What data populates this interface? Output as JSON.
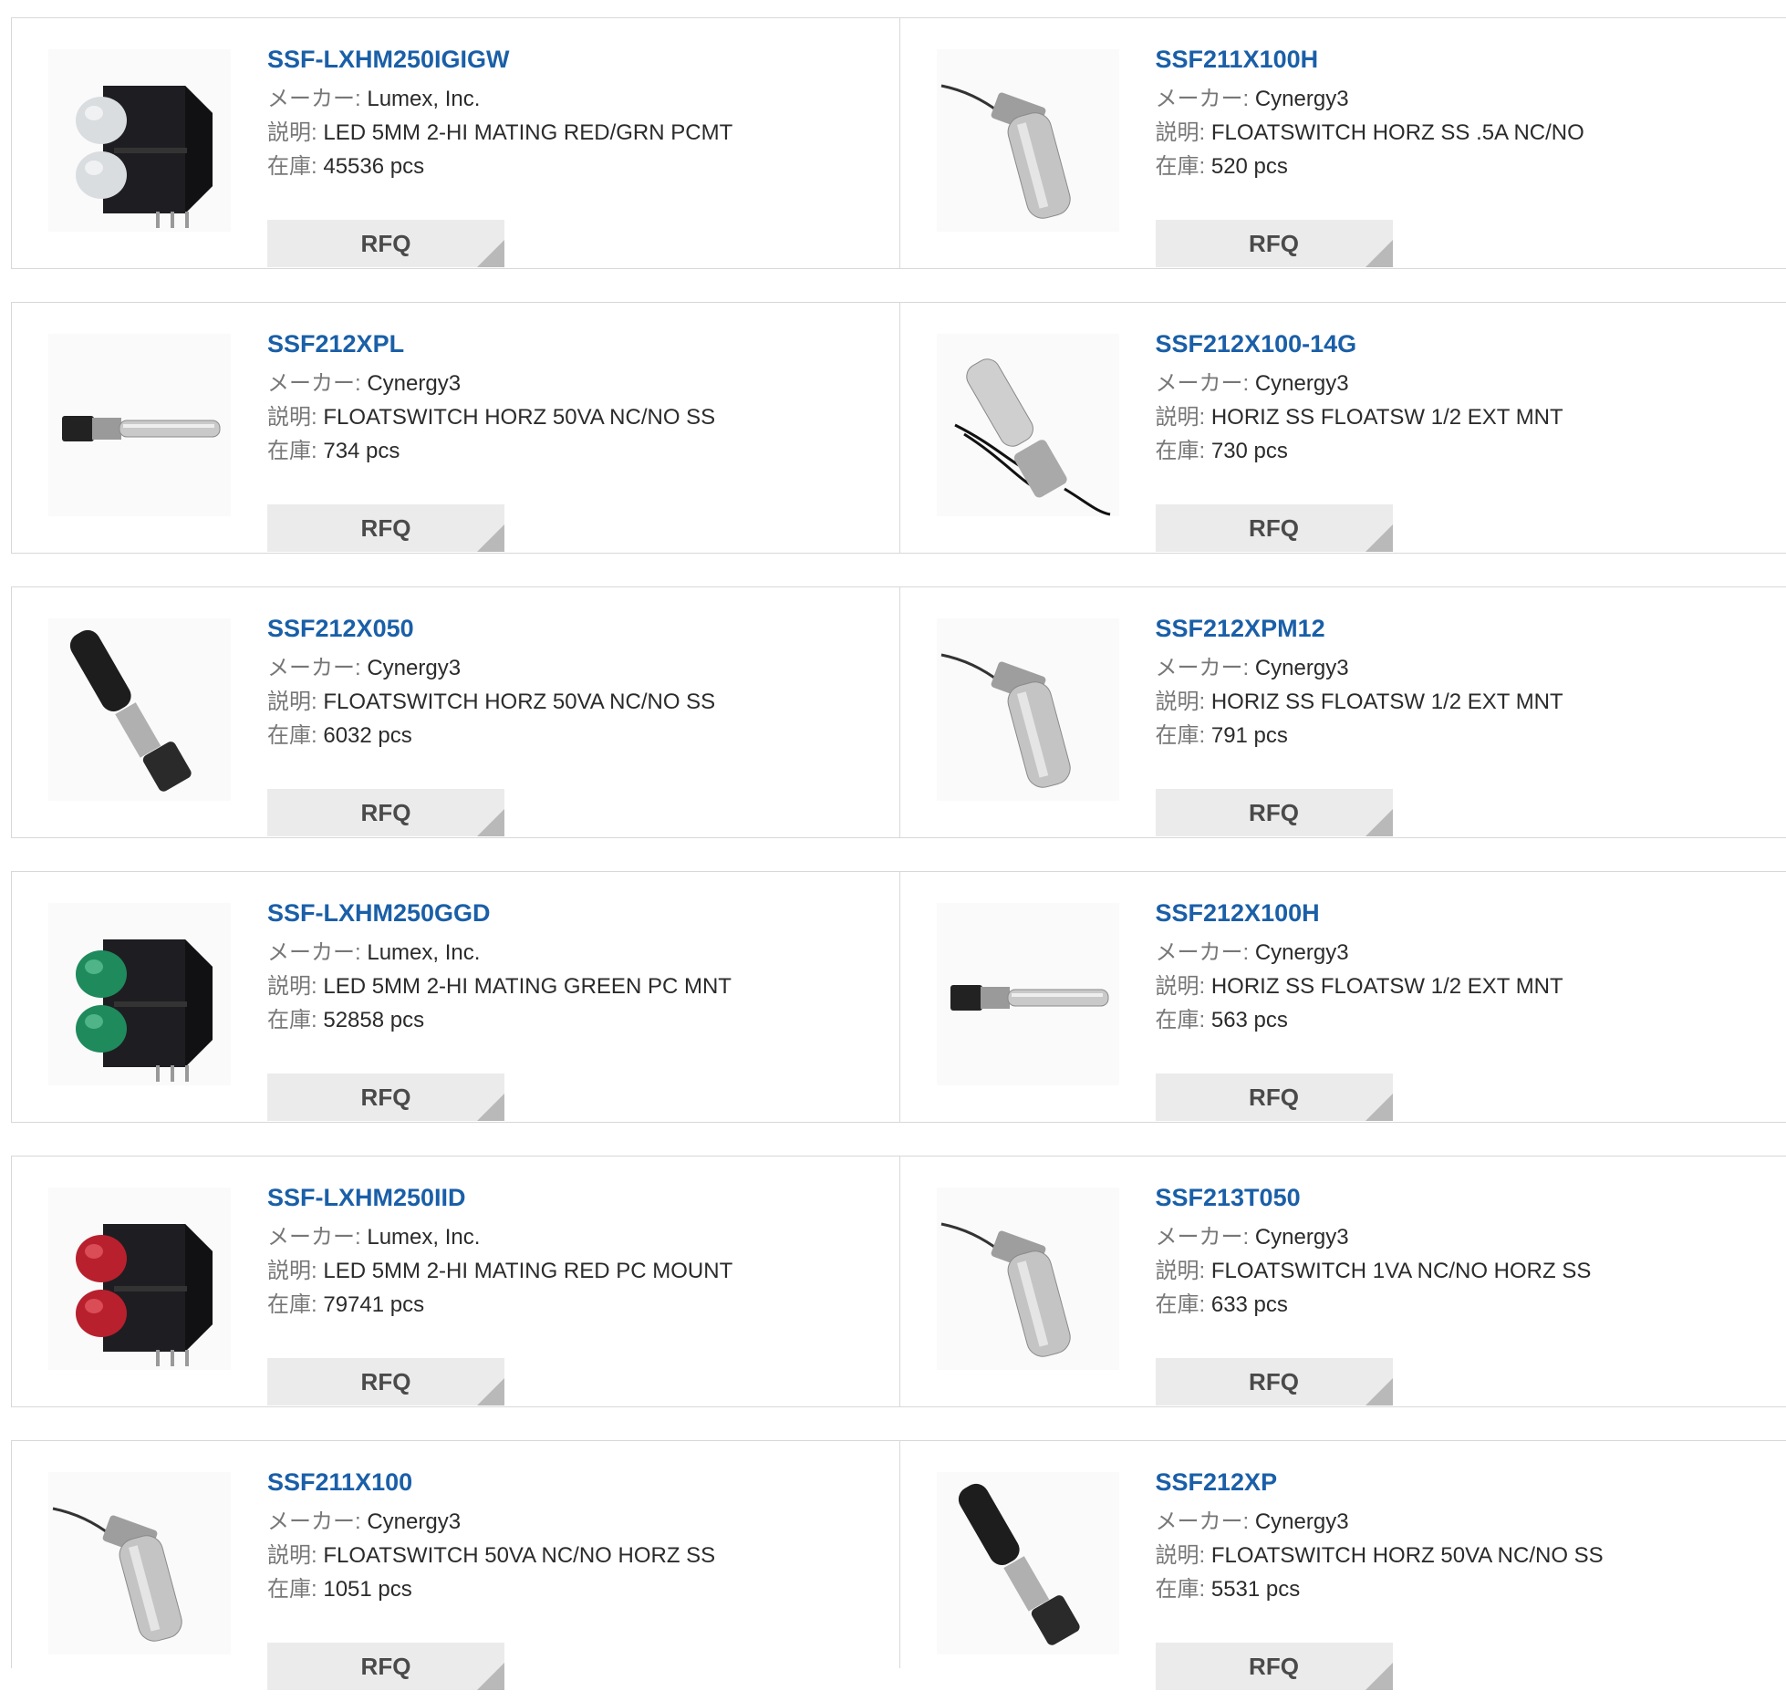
{
  "labels": {
    "maker": "メーカー:",
    "description": "説明:",
    "stock": "在庫:",
    "rfq": "RFQ"
  },
  "products": [
    {
      "part": "SSF-LXHM250IGIGW",
      "maker": "Lumex, Inc.",
      "desc": "LED 5MM 2-HI MATING RED/GRN PCMT",
      "stock": "45536 pcs",
      "icon": "led-dual-white-icon"
    },
    {
      "part": "SSF211X100H",
      "maker": "Cynergy3",
      "desc": "FLOATSWITCH HORZ SS .5A NC/NO",
      "stock": "520 pcs",
      "icon": "float-switch-icon"
    },
    {
      "part": "SSF212XPL",
      "maker": "Cynergy3",
      "desc": "FLOATSWITCH HORZ 50VA NC/NO SS",
      "stock": "734 pcs",
      "icon": "float-switch-horizontal-icon"
    },
    {
      "part": "SSF212X100-14G",
      "maker": "Cynergy3",
      "desc": "HORIZ SS FLOATSW 1/2 EXT MNT",
      "stock": "730 pcs",
      "icon": "float-switch-wired-icon"
    },
    {
      "part": "SSF212X050",
      "maker": "Cynergy3",
      "desc": "FLOATSWITCH HORZ 50VA NC/NO SS",
      "stock": "6032 pcs",
      "icon": "float-switch-black-icon"
    },
    {
      "part": "SSF212XPM12",
      "maker": "Cynergy3",
      "desc": "HORIZ SS FLOATSW 1/2 EXT MNT",
      "stock": "791 pcs",
      "icon": "float-switch-icon"
    },
    {
      "part": "SSF-LXHM250GGD",
      "maker": "Lumex, Inc.",
      "desc": "LED 5MM 2-HI MATING GREEN PC MNT",
      "stock": "52858 pcs",
      "icon": "led-dual-green-icon"
    },
    {
      "part": "SSF212X100H",
      "maker": "Cynergy3",
      "desc": "HORIZ SS FLOATSW 1/2 EXT MNT",
      "stock": "563 pcs",
      "icon": "float-switch-horizontal-icon"
    },
    {
      "part": "SSF-LXHM250IID",
      "maker": "Lumex, Inc.",
      "desc": "LED 5MM 2-HI MATING RED PC MOUNT",
      "stock": "79741 pcs",
      "icon": "led-dual-red-icon"
    },
    {
      "part": "SSF213T050",
      "maker": "Cynergy3",
      "desc": "FLOATSWITCH 1VA NC/NO HORZ SS",
      "stock": "633 pcs",
      "icon": "float-switch-icon"
    },
    {
      "part": "SSF211X100",
      "maker": "Cynergy3",
      "desc": "FLOATSWITCH 50VA NC/NO HORZ SS",
      "stock": "1051 pcs",
      "icon": "float-switch-icon"
    },
    {
      "part": "SSF212XP",
      "maker": "Cynergy3",
      "desc": "FLOATSWITCH HORZ 50VA NC/NO SS",
      "stock": "5531 pcs",
      "icon": "float-switch-black-icon"
    }
  ]
}
